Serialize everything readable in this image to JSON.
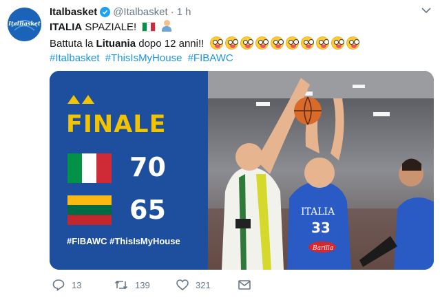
{
  "tweet": {
    "author_name": "Italbasket",
    "handle": "@Italbasket",
    "separator": "·",
    "time": "1 h",
    "avatar_text": "ItalBasket",
    "line1_bold": "ITALIA",
    "line1_rest": " SPAZIALE!",
    "line2_prefix": "Battuta la ",
    "line2_bold": "Lituania",
    "line2_suffix": " dopo 12 anni!!",
    "emoji_crazy_count": 10,
    "hashtags": [
      "#Italbasket",
      "#ThisIsMyHouse",
      "#FIBAWC"
    ]
  },
  "media": {
    "heading": "FINALE",
    "italy_score": "70",
    "lithuania_score": "65",
    "tags": "#FIBAWC #ThisIsMyHouse",
    "jersey_text": "ITALIA",
    "jersey_number": "33",
    "sponsor": "Barilla"
  },
  "actions": {
    "replies": "13",
    "retweets": "139",
    "likes": "321"
  },
  "colors": {
    "link": "#1b95e0",
    "panel_blue": "#1d4f9e",
    "finale_yellow": "#f2c400",
    "verified": "#1da1f2"
  }
}
